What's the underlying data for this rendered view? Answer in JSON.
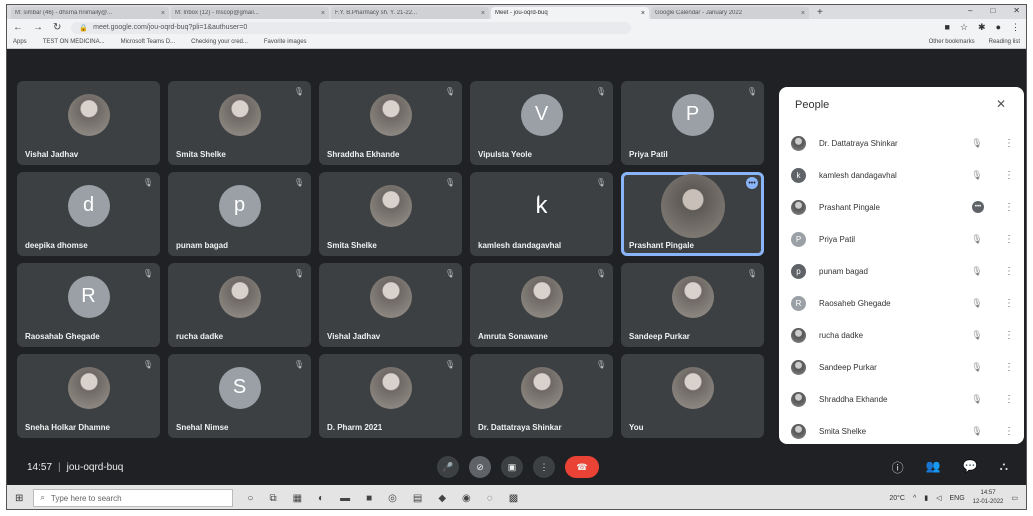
{
  "browser": {
    "tabs": [
      {
        "label": "M: simbar (46) - dhsrna hnimaily@...",
        "active": false
      },
      {
        "label": "M: Inbox (12) - mscop@gmail...",
        "active": false
      },
      {
        "label": "F.Y. B.Pharmacy sh. Y. 21-22...",
        "active": false
      },
      {
        "label": "Meet - jou-oqrd-buq",
        "active": true
      },
      {
        "label": "Google Calendar - January 2022",
        "active": false
      }
    ],
    "url": "meet.google.com/jou-oqrd-buq?pli=1&authuser=0",
    "bookmarks": [
      "Apps",
      "TEST ON MEDICINA...",
      "Microsoft Teams D...",
      "Checking your cred...",
      "Favorite images"
    ],
    "bookmarks_right": [
      "Other bookmarks",
      "Reading list"
    ]
  },
  "tiles": [
    {
      "name": "Vishal Jadhav",
      "type": "photo",
      "muted": false
    },
    {
      "name": "Smita Shelke",
      "type": "photo",
      "muted": true
    },
    {
      "name": "Shraddha Ekhande",
      "type": "photo",
      "muted": true
    },
    {
      "name": "Vipulsta Yeole",
      "type": "letter",
      "letter": "V",
      "color": "#9aa0a6",
      "muted": true
    },
    {
      "name": "Priya Patil",
      "type": "letter",
      "letter": "P",
      "color": "#9aa0a6",
      "muted": true
    },
    {
      "name": "deepika dhomse",
      "type": "letter",
      "letter": "d",
      "color": "#9aa0a6",
      "muted": true
    },
    {
      "name": "punam bagad",
      "type": "letter",
      "letter": "p",
      "color": "#9aa0a6",
      "muted": true
    },
    {
      "name": "Smita Shelke",
      "type": "photo",
      "muted": true
    },
    {
      "name": "kamlesh dandagavhal",
      "type": "plain",
      "letter": "k",
      "muted": true
    },
    {
      "name": "Prashant Pingale",
      "type": "big",
      "muted": false,
      "speaking": true
    },
    {
      "name": "Raosahab Ghegade",
      "type": "letter",
      "letter": "R",
      "color": "#9aa0a6",
      "muted": true
    },
    {
      "name": "rucha dadke",
      "type": "photo",
      "muted": true
    },
    {
      "name": "Vishal Jadhav",
      "type": "photo",
      "muted": true
    },
    {
      "name": "Amruta Sonawane",
      "type": "photo",
      "muted": true
    },
    {
      "name": "Sandeep Purkar",
      "type": "photo",
      "muted": true
    },
    {
      "name": "Sneha Holkar Dhamne",
      "type": "photo",
      "muted": true
    },
    {
      "name": "Snehal Nimse",
      "type": "letter",
      "letter": "S",
      "color": "#9aa0a6",
      "muted": true
    },
    {
      "name": "D. Pharm 2021",
      "type": "photo",
      "muted": true
    },
    {
      "name": "Dr. Dattatraya Shinkar",
      "type": "photo",
      "muted": true
    },
    {
      "name": "You",
      "type": "photo",
      "muted": false
    }
  ],
  "people": {
    "title": "People",
    "list": [
      {
        "name": "Dr. Dattatraya Shinkar",
        "type": "photo",
        "mic": "muted"
      },
      {
        "name": "kamlesh dandagavhal",
        "type": "letter",
        "letter": "k",
        "color": "#5f6368",
        "mic": "muted"
      },
      {
        "name": "Prashant Pingale",
        "type": "photo",
        "mic": "speaking"
      },
      {
        "name": "Priya Patil",
        "type": "letter",
        "letter": "P",
        "color": "#9aa0a6",
        "mic": "muted"
      },
      {
        "name": "punam bagad",
        "type": "letter",
        "letter": "p",
        "color": "#5f6368",
        "mic": "muted"
      },
      {
        "name": "Raosaheb Ghegade",
        "type": "letter",
        "letter": "R",
        "color": "#9aa0a6",
        "mic": "muted"
      },
      {
        "name": "rucha dadke",
        "type": "photo",
        "mic": "muted"
      },
      {
        "name": "Sandeep Purkar",
        "type": "photo",
        "mic": "muted"
      },
      {
        "name": "Shraddha Ekhande",
        "type": "photo",
        "mic": "muted"
      },
      {
        "name": "Smita Shelke",
        "type": "photo",
        "mic": "muted"
      }
    ]
  },
  "meeting": {
    "time": "14:57",
    "code": "jou-oqrd-buq"
  },
  "taskbar": {
    "search_placeholder": "Type here to search",
    "weather": "20°C",
    "clock_time": "14:57",
    "clock_date": "12-01-2022",
    "lang": "ENG"
  }
}
